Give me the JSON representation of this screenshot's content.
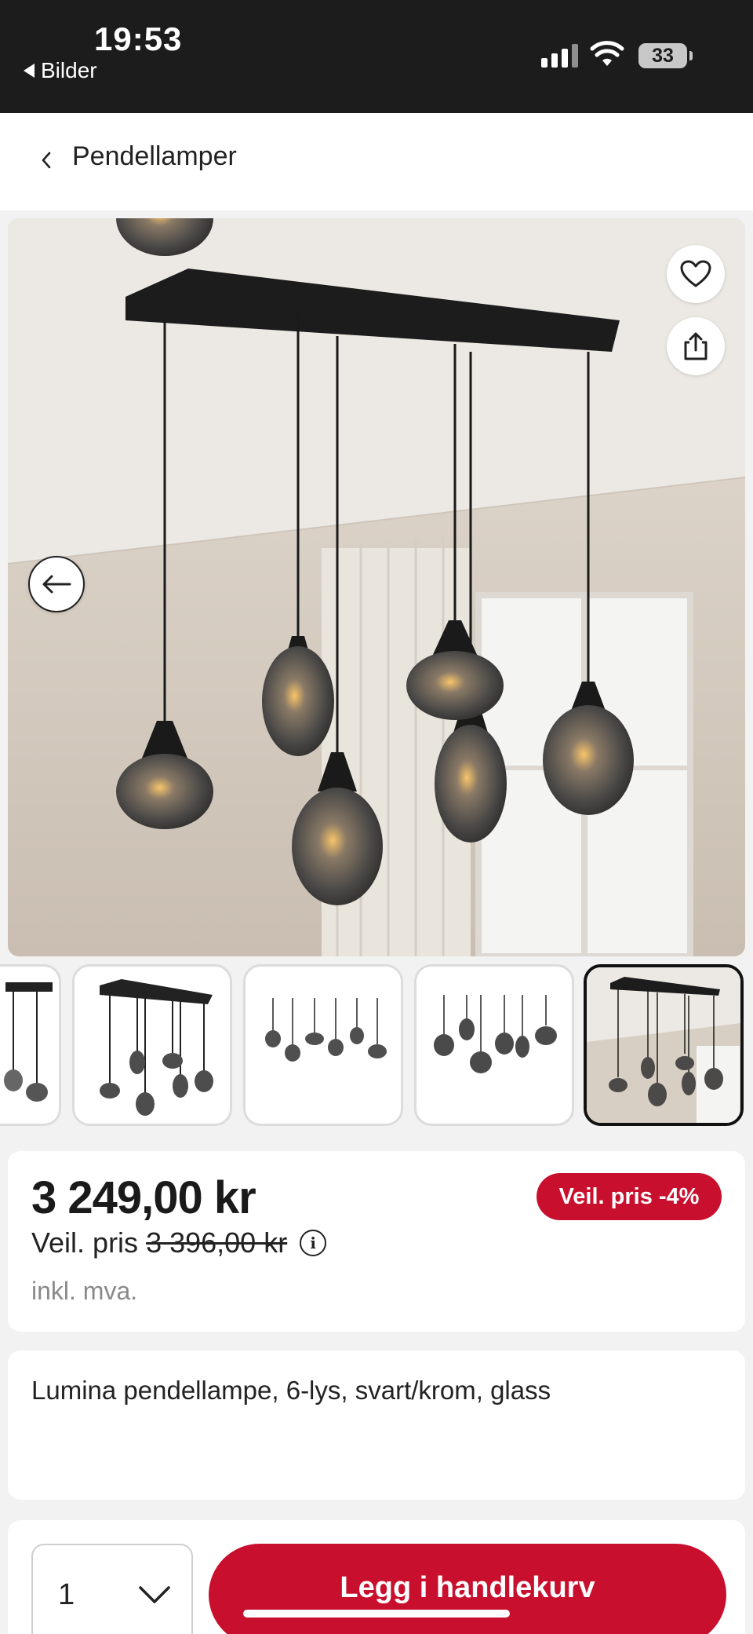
{
  "status_bar": {
    "time": "19:53",
    "back_app": "Bilder",
    "battery": "33",
    "icons": [
      "signal-icon",
      "wifi-icon",
      "battery-icon"
    ]
  },
  "nav": {
    "title": "Pendellamper",
    "back_icon": "chevron-left-icon"
  },
  "gallery": {
    "actions": [
      "heart-icon",
      "share-icon",
      "arrow-left-icon"
    ],
    "thumbnail_count": 5,
    "active_thumbnail": 5
  },
  "price": {
    "current": "3 249,00 kr",
    "rrp_label": "Veil. pris",
    "rrp_value": "3 396,00 kr",
    "vat": "inkl. mva.",
    "badge": "Veil. pris -4%",
    "badge_color": "#c8102e"
  },
  "product": {
    "name": "Lumina pendellampe, 6-lys, svart/krom, glass"
  },
  "purchase": {
    "quantity": "1",
    "add_to_cart": "Legg i handlekurv",
    "accent": "#c8102e"
  }
}
